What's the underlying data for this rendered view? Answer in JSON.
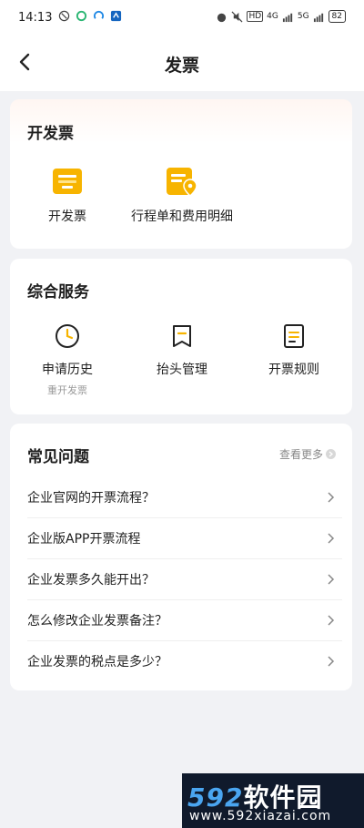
{
  "status": {
    "time": "14:13",
    "network1": "4G",
    "network2": "5G",
    "battery": "82"
  },
  "nav": {
    "title": "发票"
  },
  "invoice_section": {
    "title": "开发票",
    "items": [
      {
        "label": "开发票",
        "icon": "invoice-icon"
      },
      {
        "label": "行程单和费用明细",
        "icon": "itinerary-icon"
      }
    ]
  },
  "service_section": {
    "title": "综合服务",
    "items": [
      {
        "label": "申请历史",
        "sub": "重开发票",
        "icon": "clock-icon"
      },
      {
        "label": "抬头管理",
        "icon": "bookmark-icon"
      },
      {
        "label": "开票规则",
        "icon": "list-doc-icon"
      }
    ]
  },
  "faq_section": {
    "title": "常见问题",
    "more": "查看更多",
    "items": [
      "企业官网的开票流程？",
      "企业版APP开票流程",
      "企业发票多久能开出？",
      "怎么修改企业发票备注？",
      "企业发票的税点是多少？"
    ]
  },
  "watermark": {
    "number": "592",
    "name": "软件园",
    "url": "www.592xiazai.com"
  },
  "colors": {
    "accent_yellow": "#f7b400",
    "text": "#1f1f1f",
    "muted": "#999999"
  }
}
